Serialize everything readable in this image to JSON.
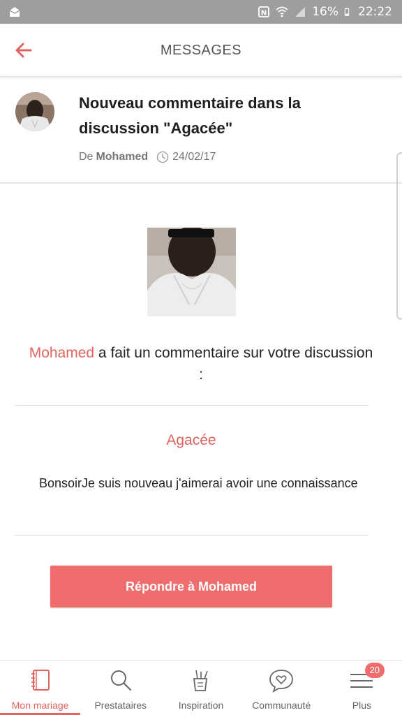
{
  "status_bar": {
    "battery": "16%",
    "time": "22:22",
    "icons": [
      "mail-icon",
      "nfc-icon",
      "wifi-icon",
      "signal-icon",
      "battery-icon"
    ]
  },
  "header": {
    "title": "MESSAGES",
    "back_icon": "arrow-left-icon"
  },
  "notification": {
    "headline": "Nouveau commentaire dans la discussion \"Agacée\"",
    "from_prefix": "De",
    "author": "Mohamed",
    "date": "24/02/17"
  },
  "message": {
    "author": "Mohamed",
    "intro_rest": " a fait un commentaire sur votre discussion :",
    "discussion_title": "Agacée",
    "comment": "BonsoirJe suis nouveau j'aimerai avoir une connaissance",
    "reply_label": "Répondre à Mohamed"
  },
  "bottom_nav": {
    "items": [
      {
        "label": "Mon mariage",
        "icon": "notebook-icon",
        "active": true
      },
      {
        "label": "Prestataires",
        "icon": "search-icon",
        "active": false
      },
      {
        "label": "Inspiration",
        "icon": "pencil-cup-icon",
        "active": false
      },
      {
        "label": "Communauté",
        "icon": "chat-heart-icon",
        "active": false
      },
      {
        "label": "Plus",
        "icon": "menu-icon",
        "active": false,
        "badge": "20"
      }
    ]
  },
  "colors": {
    "accent": "#e0645f",
    "button": "#f06d6d",
    "status_bar": "#9e9e9e"
  }
}
